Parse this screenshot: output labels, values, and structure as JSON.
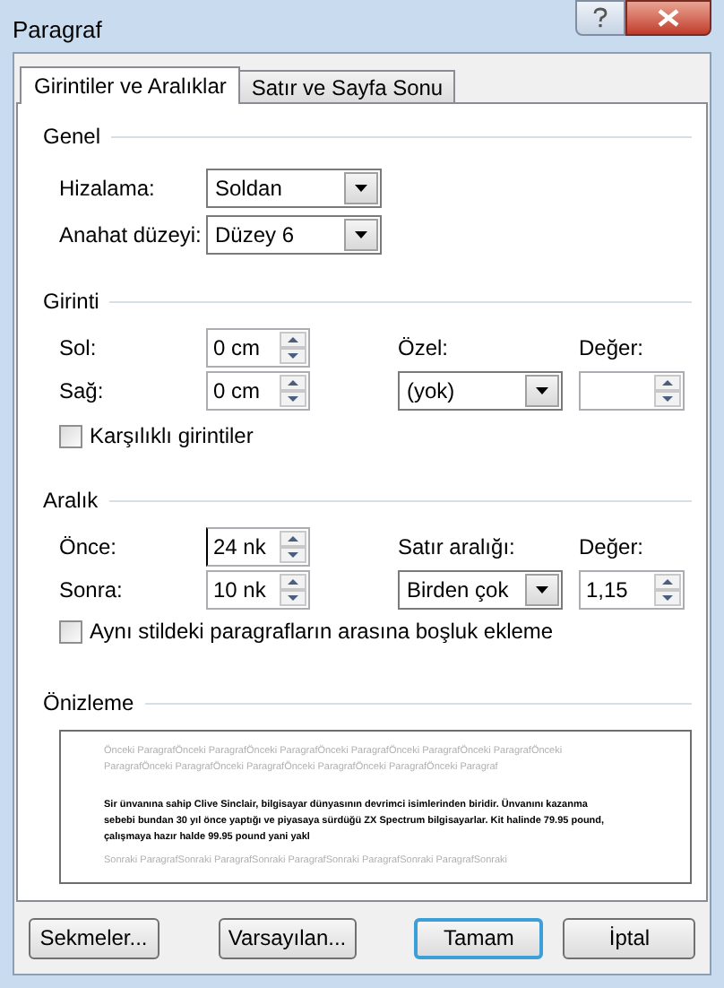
{
  "window": {
    "title": "Paragraf"
  },
  "tabs": [
    {
      "label": "Girintiler ve Aralıklar",
      "selected": true
    },
    {
      "label": "Satır ve Sayfa Sonu",
      "selected": false
    }
  ],
  "general": {
    "title": "Genel",
    "alignment": {
      "label": "Hizalama:",
      "value": "Soldan"
    },
    "outline_level": {
      "label": "Anahat düzeyi:",
      "value": "Düzey 6"
    }
  },
  "indentation": {
    "title": "Girinti",
    "left": {
      "label": "Sol:",
      "value": "0 cm"
    },
    "right": {
      "label": "Sağ:",
      "value": "0 cm"
    },
    "special": {
      "label": "Özel:",
      "value": "(yok)"
    },
    "by": {
      "label": "Değer:"
    },
    "mirror": {
      "label": "Karşılıklı girintiler",
      "checked": false
    }
  },
  "spacing": {
    "title": "Aralık",
    "before": {
      "label": "Önce:",
      "value": "24 nk"
    },
    "after": {
      "label": "Sonra:",
      "value": "10 nk"
    },
    "line_spacing": {
      "label": "Satır aralığı:",
      "value": "Birden çok"
    },
    "at": {
      "label": "Değer:",
      "value": "1,15"
    },
    "no_space": {
      "label": "Aynı stildeki paragrafların arasına boşluk ekleme",
      "checked": false
    }
  },
  "preview": {
    "title": "Önizleme",
    "previous_text": "Önceki ParagrafÖnceki ParagrafÖnceki ParagrafÖnceki ParagrafÖnceki ParagrafÖnceki ParagrafÖnceki ParagrafÖnceki ParagrafÖnceki ParagrafÖnceki ParagrafÖnceki ParagrafÖnceki Paragraf",
    "sample_text": "Sir ünvanına sahip Clive Sinclair, bilgisayar dünyasının devrimci isimlerinden biridir. Ünvanını kazanma sebebi bundan 30 yıl önce yaptığı ve piyasaya sürdüğü ZX Spectrum bilgisayarlar. Kit halinde 79.95 pound, çalışmaya hazır halde 99.95 pound yani yakl",
    "next_text": "Sonraki ParagrafSonraki ParagrafSonraki ParagrafSonraki ParagrafSonraki ParagrafSonraki"
  },
  "buttons": [
    {
      "label": "Sekmeler...",
      "default": false
    },
    {
      "label": "Varsayılan...",
      "default": false
    },
    {
      "label": "Tamam",
      "default": true
    },
    {
      "label": "İptal",
      "default": false
    }
  ]
}
